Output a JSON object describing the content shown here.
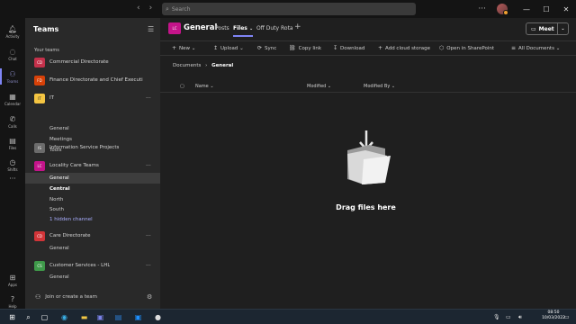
{
  "titlebar": {
    "search_placeholder": "Search",
    "more": "···"
  },
  "rail": {
    "items": [
      {
        "label": "Activity",
        "icon": "bell-icon"
      },
      {
        "label": "Chat",
        "icon": "chat-icon"
      },
      {
        "label": "Teams",
        "icon": "teams-icon"
      },
      {
        "label": "Calendar",
        "icon": "calendar-icon"
      },
      {
        "label": "Calls",
        "icon": "phone-icon"
      },
      {
        "label": "Files",
        "icon": "file-icon"
      },
      {
        "label": "Shifts",
        "icon": "clock-icon"
      },
      {
        "label": "···",
        "icon": "more-icon"
      },
      {
        "label": "Apps",
        "icon": "apps-icon"
      },
      {
        "label": "Help",
        "icon": "help-icon"
      }
    ]
  },
  "teams_panel": {
    "title": "Teams",
    "your_teams": "Your teams",
    "teams": [
      {
        "initials": "CD",
        "name": "Commercial Directorate",
        "color": "#c4314b"
      },
      {
        "initials": "FD",
        "name": "Finance Directorate and Chief Executi...",
        "color": "#d74108"
      },
      {
        "initials": "IT",
        "name": "IT",
        "color": "#f4c542",
        "channels": [
          "General",
          "Meetings",
          "Tools"
        ]
      },
      {
        "initials": "IS",
        "name": "Information Service Projects",
        "color": "#6b6b6b"
      },
      {
        "initials": "LC",
        "name": "Locality Care Teams",
        "color": "#c4148a",
        "channels": [
          "General",
          "Central",
          "North",
          "South",
          "1 hidden channel"
        ]
      },
      {
        "initials": "CD",
        "name": "Care Directorate",
        "color": "#d13438",
        "channels": [
          "General"
        ]
      },
      {
        "initials": "CS",
        "name": "Customer Services - LHL",
        "color": "#3f9a4a",
        "channels": [
          "General"
        ]
      }
    ],
    "join": "Join or create a team"
  },
  "channel": {
    "tile": "LC",
    "title": "General",
    "tabs": [
      "Posts",
      "Files",
      "Off Duty Rota"
    ],
    "meet": "Meet"
  },
  "toolbar": {
    "new": "New",
    "upload": "Upload",
    "sync": "Sync",
    "copy_link": "Copy link",
    "download": "Download",
    "add_cloud": "Add cloud storage",
    "open_sharepoint": "Open in SharePoint",
    "all_documents": "All Documents"
  },
  "breadcrumb": {
    "root": "Documents",
    "current": "General"
  },
  "columns": {
    "name": "Name",
    "modified": "Modified",
    "modified_by": "Modified By"
  },
  "empty_state": {
    "message": "Drag files here"
  },
  "taskbar": {
    "time": "08:50",
    "date": "10/03/2022"
  }
}
